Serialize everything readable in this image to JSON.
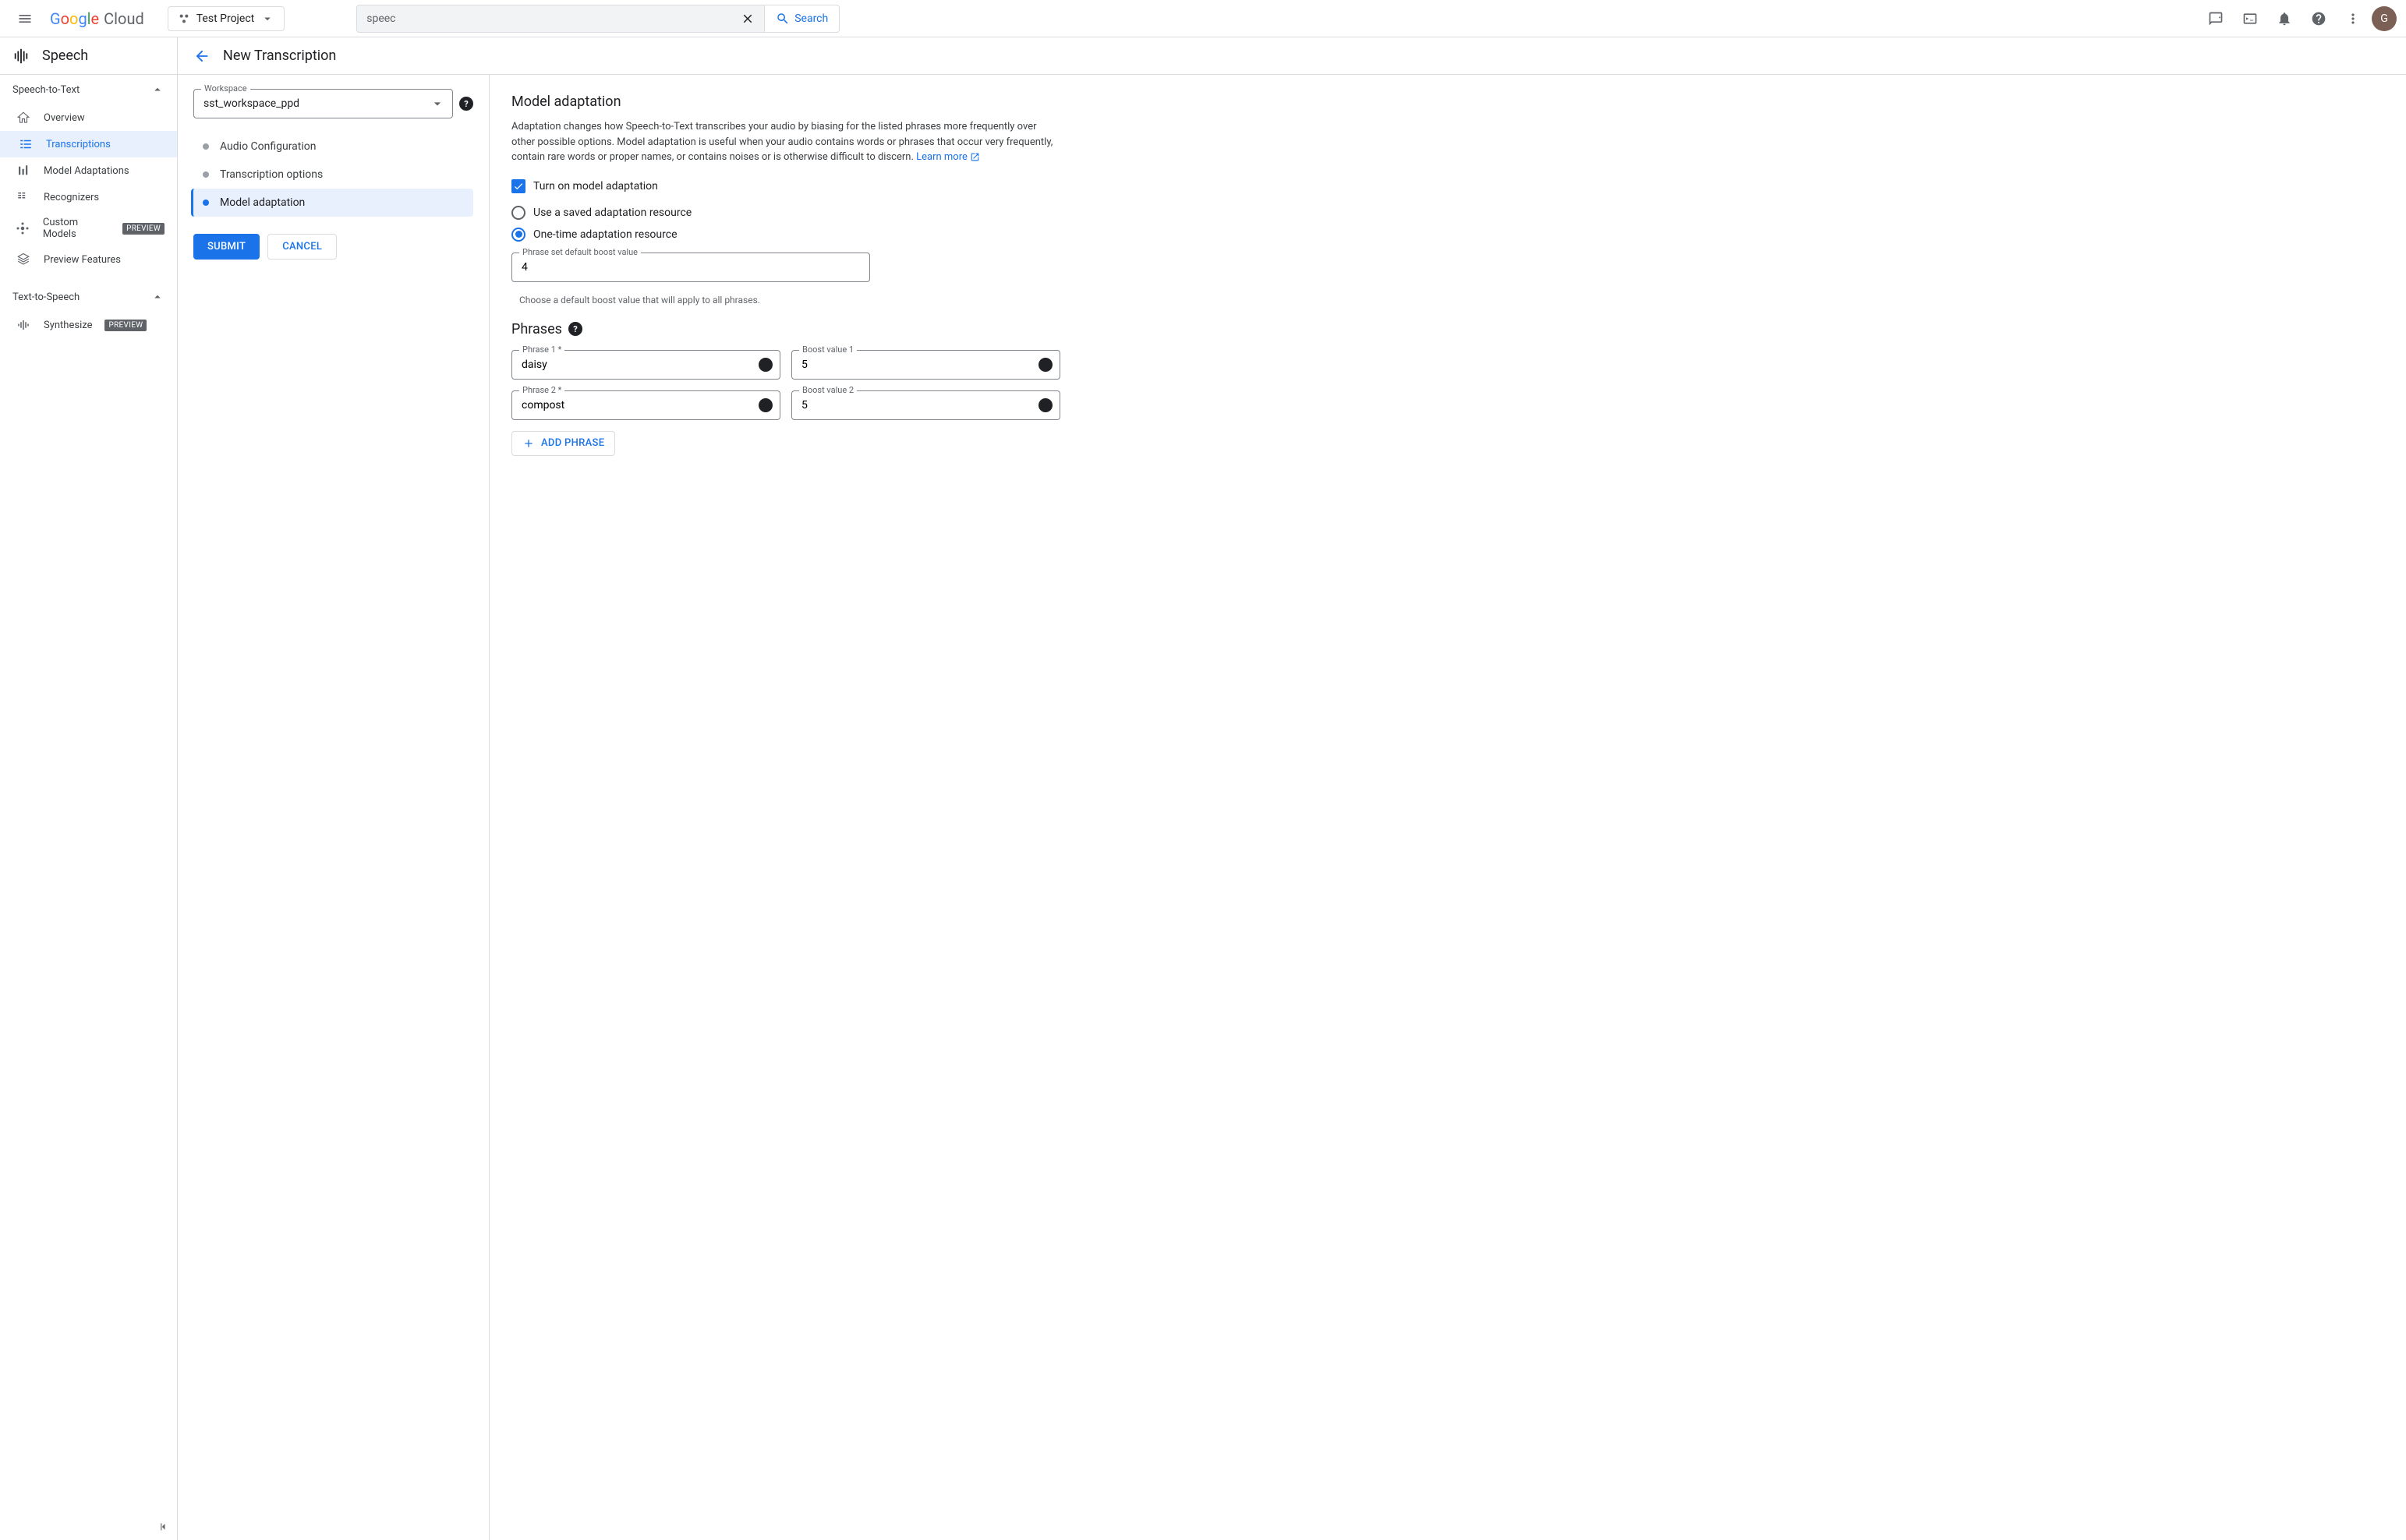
{
  "topbar": {
    "project_label": "Test Project",
    "search_value": "speec",
    "search_button": "Search",
    "avatar_letter": "G"
  },
  "sidebar": {
    "product_title": "Speech",
    "group_stt": "Speech-to-Text",
    "items_stt": [
      {
        "label": "Overview"
      },
      {
        "label": "Transcriptions"
      },
      {
        "label": "Model Adaptations"
      },
      {
        "label": "Recognizers"
      },
      {
        "label": "Custom Models",
        "badge": "PREVIEW"
      },
      {
        "label": "Preview Features"
      }
    ],
    "group_tts": "Text-to-Speech",
    "items_tts": [
      {
        "label": "Synthesize",
        "badge": "PREVIEW"
      }
    ]
  },
  "page": {
    "title": "New Transcription",
    "workspace_label": "Workspace",
    "workspace_value": "sst_workspace_ppd",
    "steps": [
      "Audio Configuration",
      "Transcription options",
      "Model adaptation"
    ],
    "submit": "SUBMIT",
    "cancel": "CANCEL"
  },
  "adaptation": {
    "heading": "Model adaptation",
    "description": "Adaptation changes how Speech-to-Text transcribes your audio by biasing for the listed phrases more frequently over other possible options. Model adaptation is useful when your audio contains words or phrases that occur very frequently, contain rare words or proper names, or contains noises or is otherwise difficult to discern. ",
    "learn_more": "Learn more",
    "toggle_label": "Turn on model adaptation",
    "radio_saved": "Use a saved adaptation resource",
    "radio_onetime": "One-time adaptation resource",
    "boost_label": "Phrase set default boost value",
    "boost_value": "4",
    "boost_hint": "Choose a default boost value that will apply to all phrases.",
    "phrases_heading": "Phrases",
    "phrases": [
      {
        "phrase_label": "Phrase 1 *",
        "phrase_value": "daisy",
        "boost_label": "Boost value 1",
        "boost_value": "5"
      },
      {
        "phrase_label": "Phrase 2 *",
        "phrase_value": "compost",
        "boost_label": "Boost value 2",
        "boost_value": "5"
      }
    ],
    "add_phrase": "ADD PHRASE"
  }
}
